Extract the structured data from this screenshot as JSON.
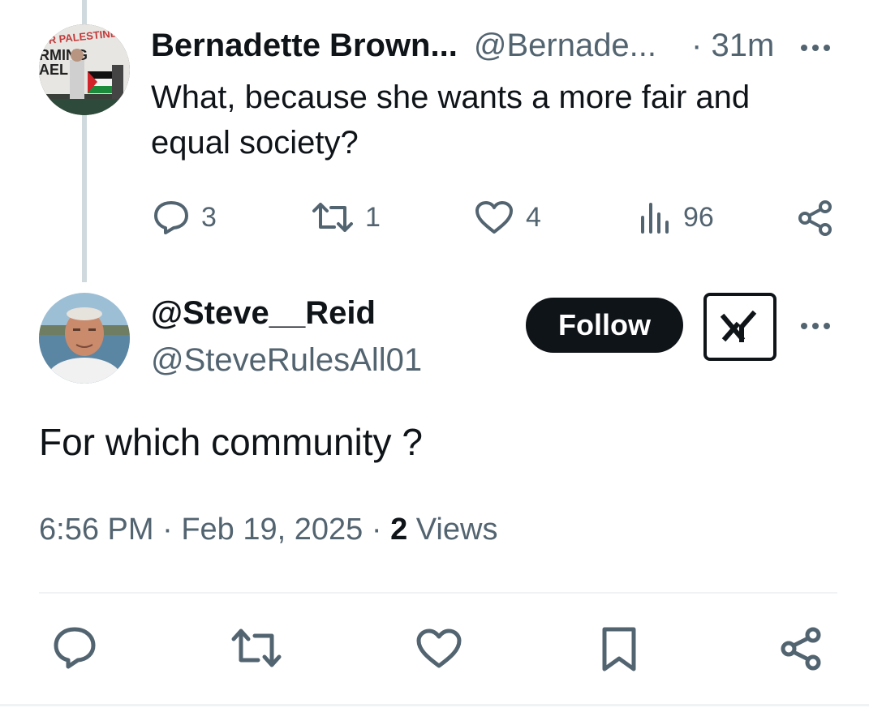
{
  "reply": {
    "display_name": "Bernadette Brown...",
    "handle": "@Bernade...",
    "separator": "·",
    "time": "31m",
    "text": "What, because she wants a more fair and equal society?",
    "avatar_sign_lines": [
      "R PALESTINE",
      "RMING",
      "AEL"
    ],
    "stats": {
      "replies": "3",
      "reposts": "1",
      "likes": "4",
      "views": "96"
    }
  },
  "tweet": {
    "display_name": "@Steve__Reid",
    "handle": "@SteveRulesAll01",
    "follow_label": "Follow",
    "text": "For which community ?",
    "time": "6:56 PM",
    "date": "Feb 19, 2025",
    "separator": "·",
    "views_count": "2",
    "views_label": "Views"
  },
  "icons": {
    "reply": "reply-icon",
    "repost": "repost-icon",
    "like": "heart-icon",
    "views": "views-chart-icon",
    "share": "share-icon",
    "bookmark": "bookmark-icon",
    "more": "more-dots-icon",
    "grok": "grok-icon"
  },
  "colors": {
    "text": "#0f1419",
    "muted": "#536471",
    "thread_line": "#cfd9de",
    "divider": "#eff3f4"
  }
}
